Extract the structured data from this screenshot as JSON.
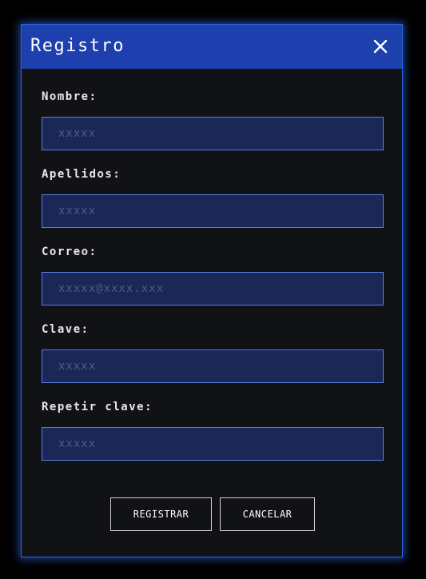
{
  "modal": {
    "title": "Registro",
    "close_icon": "close-icon"
  },
  "fields": [
    {
      "label": "Nombre:",
      "placeholder": "xxxxx",
      "value": ""
    },
    {
      "label": "Apellidos:",
      "placeholder": "xxxxx",
      "value": ""
    },
    {
      "label": "Correo:",
      "placeholder": "xxxxx@xxxx.xxx",
      "value": ""
    },
    {
      "label": "Clave:",
      "placeholder": "xxxxx",
      "value": ""
    },
    {
      "label": "Repetir clave:",
      "placeholder": "xxxxx",
      "value": ""
    }
  ],
  "actions": {
    "register_label": "REGISTRAR",
    "cancel_label": "CANCELAR"
  },
  "colors": {
    "header": "#1e40af",
    "modal_bg": "#111216",
    "input_bg": "#1a2757",
    "input_border": "#5a7fe0",
    "glow": "#2b62d9"
  }
}
